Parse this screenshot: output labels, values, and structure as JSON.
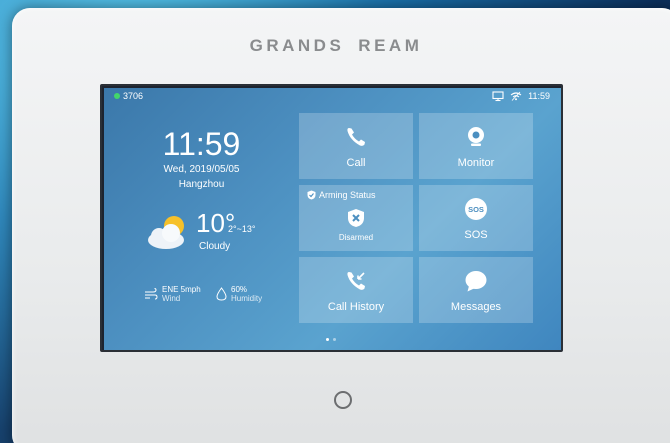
{
  "device": {
    "brand_left": "GRANDS",
    "brand_right": "REAM"
  },
  "status_bar": {
    "extension": "3706",
    "time": "11:59",
    "icons": [
      "screen-icon",
      "wifi-icon"
    ]
  },
  "clock_widget": {
    "time": "11:59",
    "date": "Wed, 2019/05/05",
    "city": "Hangzhou"
  },
  "weather": {
    "icon": "partly-cloudy-icon",
    "temperature": "10°",
    "range": "2°~13°",
    "condition": "Cloudy",
    "wind_value": "ENE 5mph",
    "wind_label": "Wind",
    "humidity_value": "60%",
    "humidity_label": "Humidity"
  },
  "tiles": [
    {
      "id": "call",
      "label": "Call",
      "icon": "phone-icon"
    },
    {
      "id": "monitor",
      "label": "Monitor",
      "icon": "camera-icon"
    },
    {
      "id": "arming",
      "title": "Arming Status",
      "state": "Disarmed",
      "icon": "shield-x-icon"
    },
    {
      "id": "sos",
      "label": "SOS",
      "icon": "sos-icon"
    },
    {
      "id": "call_history",
      "label": "Call History",
      "icon": "call-history-icon"
    },
    {
      "id": "messages",
      "label": "Messages",
      "icon": "chat-bubble-icon"
    }
  ],
  "pager": {
    "pages": 2,
    "current": 1
  },
  "colors": {
    "status_dot": "#43d66a",
    "screen_bg": "#4c8fc0"
  }
}
